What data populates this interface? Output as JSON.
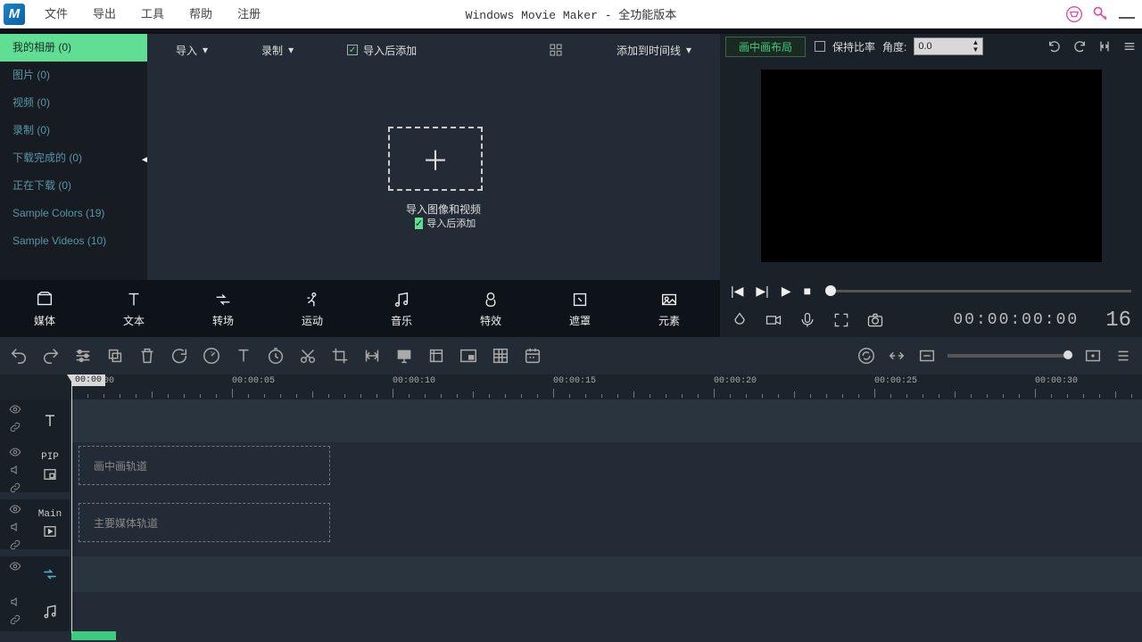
{
  "menubar": {
    "logo_letter": "M",
    "items": [
      "文件",
      "导出",
      "工具",
      "帮助",
      "注册"
    ],
    "title": "Windows Movie Maker    - 全功能版本"
  },
  "sidebar": {
    "items": [
      {
        "label": "我的相册 (0)",
        "active": true
      },
      {
        "label": "图片 (0)"
      },
      {
        "label": "视频 (0)"
      },
      {
        "label": "录制 (0)"
      },
      {
        "label": "下载完成的 (0)"
      },
      {
        "label": "正在下载 (0)"
      },
      {
        "label": "Sample Colors (19)"
      },
      {
        "label": "Sample Videos (10)"
      }
    ]
  },
  "media_top": {
    "import": "导入",
    "record": "录制",
    "add_after": "导入后添加",
    "add_timeline": "添加到时间线"
  },
  "media_drop": {
    "label": "导入图像和视频",
    "sub": "导入后添加"
  },
  "preview": {
    "layout_btn": "画中画布局",
    "keep_ratio": "保持比率",
    "angle_lbl": "角度:",
    "angle_val": "0.0",
    "timecode": "00:00:00:00",
    "fps": "16"
  },
  "modules": [
    "媒体",
    "文本",
    "转场",
    "运动",
    "音乐",
    "特效",
    "遮罩",
    "元素"
  ],
  "ruler": {
    "marks": [
      "00:00:00",
      "00:00:05",
      "00:00:10",
      "00:00:15",
      "00:00:20",
      "00:00:25",
      "00:00:30"
    ],
    "badge": "00:00"
  },
  "tracks": {
    "pip_name": "PIP",
    "main_name": "Main",
    "pip_hint": "画中画轨道",
    "main_hint": "主要媒体轨道"
  }
}
